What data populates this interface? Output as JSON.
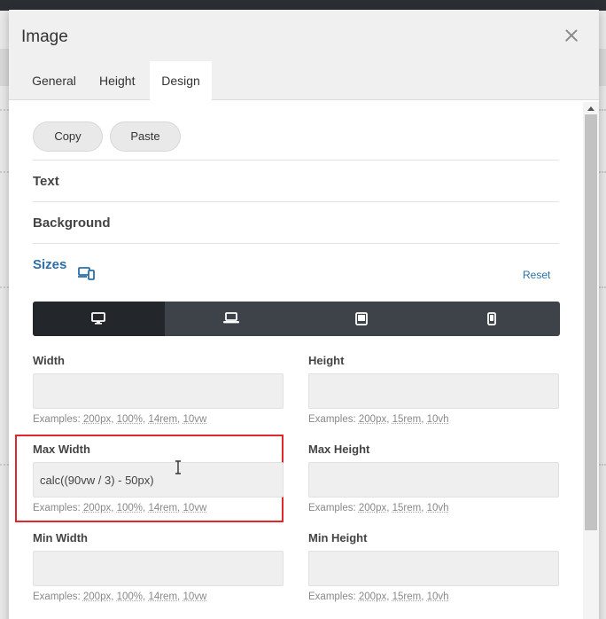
{
  "modal": {
    "title": "Image",
    "tabs": [
      {
        "label": "General"
      },
      {
        "label": "Height"
      },
      {
        "label": "Design",
        "active": true
      }
    ]
  },
  "toolbar": {
    "copy_label": "Copy",
    "paste_label": "Paste"
  },
  "sections": {
    "text": "Text",
    "background": "Background",
    "sizes": "Sizes",
    "reset": "Reset"
  },
  "device_tabs": [
    {
      "icon": "desktop-icon",
      "active": true
    },
    {
      "icon": "laptop-icon",
      "active": false
    },
    {
      "icon": "tablet-icon",
      "active": false
    },
    {
      "icon": "phone-icon",
      "active": false
    }
  ],
  "fields": {
    "width": {
      "label": "Width",
      "value": "",
      "examples": [
        "200px",
        "100%",
        "14rem",
        "10vw"
      ]
    },
    "height": {
      "label": "Height",
      "value": "",
      "examples": [
        "200px",
        "15rem",
        "10vh"
      ]
    },
    "max_width": {
      "label": "Max Width",
      "value": "calc((90vw / 3) - 50px)",
      "examples": [
        "200px",
        "100%",
        "14rem",
        "10vw"
      ]
    },
    "max_height": {
      "label": "Max Height",
      "value": "",
      "examples": [
        "200px",
        "15rem",
        "10vh"
      ]
    },
    "min_width": {
      "label": "Min Width",
      "value": "",
      "examples": [
        "200px",
        "100%",
        "14rem",
        "10vw"
      ]
    },
    "min_height": {
      "label": "Min Height",
      "value": "",
      "examples": [
        "200px",
        "15rem",
        "10vh"
      ]
    }
  },
  "examples_prefix": "Examples:",
  "colors": {
    "accent": "#2a6fa8",
    "highlight": "#e0282c",
    "device_bar": "#3e4349",
    "device_active": "#23272b"
  }
}
